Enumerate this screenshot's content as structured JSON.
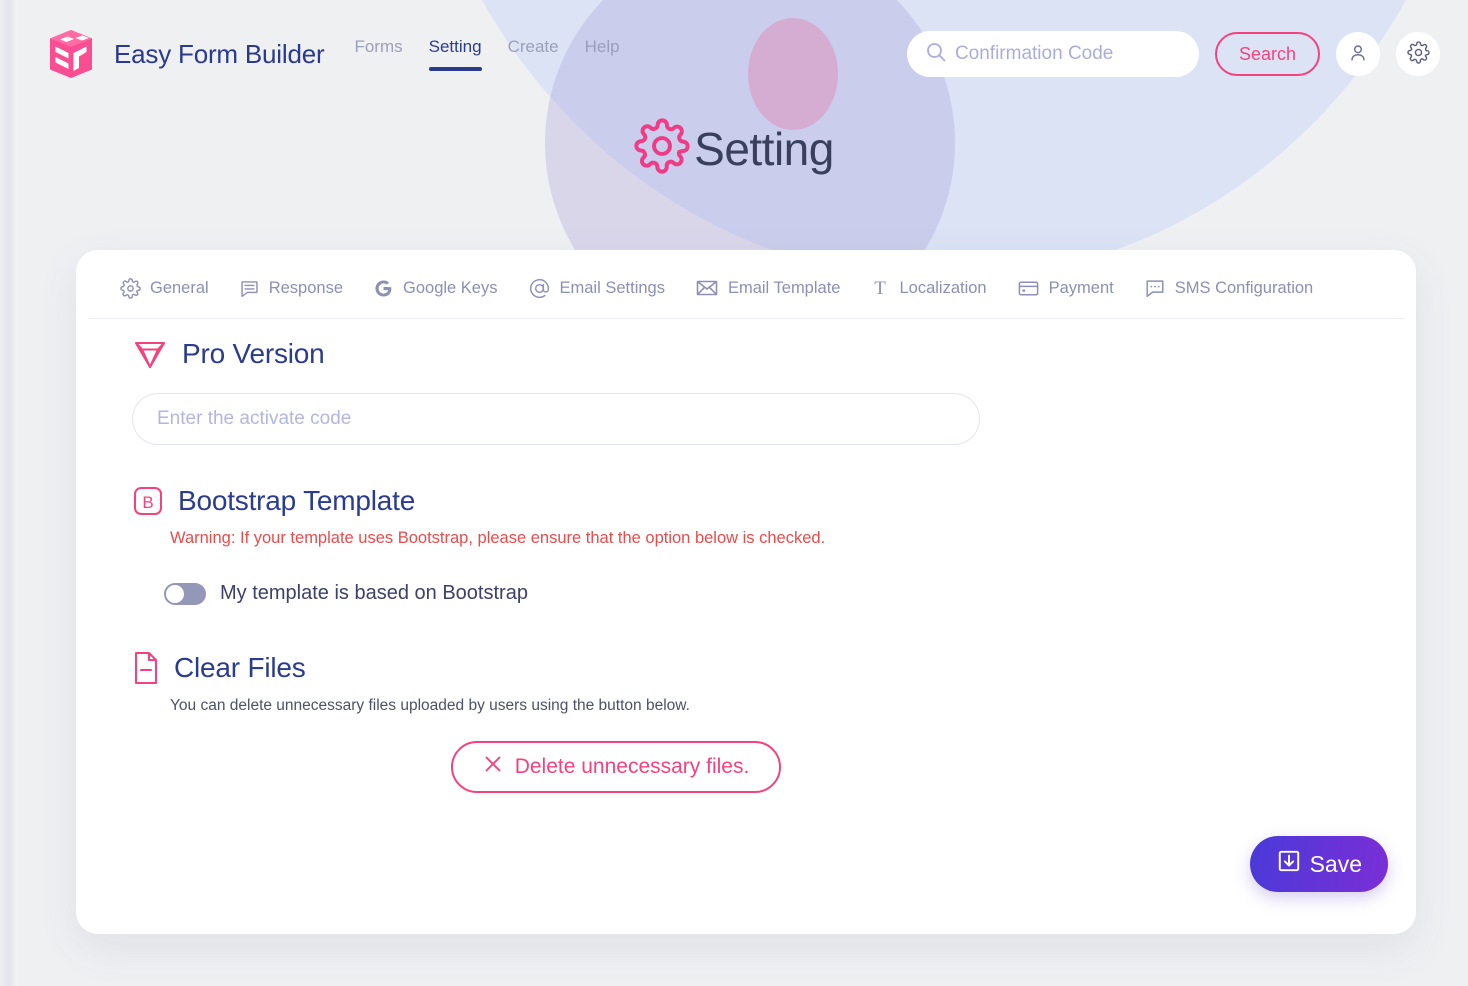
{
  "brand": {
    "name": "Easy Form Builder",
    "logo_icon": "cube-logo-icon",
    "logo_color": "#fb4d92"
  },
  "nav": {
    "items": [
      {
        "label": "Forms",
        "active": false
      },
      {
        "label": "Setting",
        "active": true
      },
      {
        "label": "Create",
        "active": false
      },
      {
        "label": "Help",
        "active": false
      }
    ]
  },
  "search": {
    "placeholder": "Confirmation Code",
    "value": "",
    "icon": "search-icon",
    "button_label": "Search"
  },
  "header_icons": {
    "account": "user-icon",
    "settings": "gear-icon"
  },
  "page_title": {
    "text": "Setting",
    "icon": "gear-icon"
  },
  "tabs": [
    {
      "label": "General",
      "icon": "gear-icon"
    },
    {
      "label": "Response",
      "icon": "comment-lines-icon"
    },
    {
      "label": "Google Keys",
      "icon": "google-g-icon"
    },
    {
      "label": "Email Settings",
      "icon": "at-sign-icon"
    },
    {
      "label": "Email Template",
      "icon": "envelope-icon"
    },
    {
      "label": "Localization",
      "icon": "text-t-icon"
    },
    {
      "label": "Payment",
      "icon": "credit-card-icon"
    },
    {
      "label": "SMS Configuration",
      "icon": "chat-dots-icon"
    }
  ],
  "sections": {
    "pro_version": {
      "title": "Pro Version",
      "icon": "diamond-icon",
      "input_placeholder": "Enter the activate code",
      "input_value": ""
    },
    "bootstrap": {
      "title": "Bootstrap Template",
      "icon": "bootstrap-b-icon",
      "warning": "Warning: If your template uses Bootstrap, please ensure that the option below is checked.",
      "toggle_label": "My template is based on Bootstrap",
      "toggle_on": false
    },
    "clear_files": {
      "title": "Clear Files",
      "icon": "file-minus-icon",
      "description": "You can delete unnecessary files uploaded by users using the button below.",
      "delete_button_label": "Delete unnecessary files.",
      "delete_button_icon": "close-x-icon"
    }
  },
  "footer": {
    "save_label": "Save",
    "save_icon": "download-box-icon"
  },
  "colors": {
    "accent_pink": "#f4427f",
    "brand_navy": "#2a3a8c",
    "warning_red": "#ea4b4b",
    "save_gradient_start": "#4a3ad8",
    "save_gradient_end": "#7b2ed6",
    "tab_text": "#8b90b4",
    "page_background": "#eff0f2"
  }
}
